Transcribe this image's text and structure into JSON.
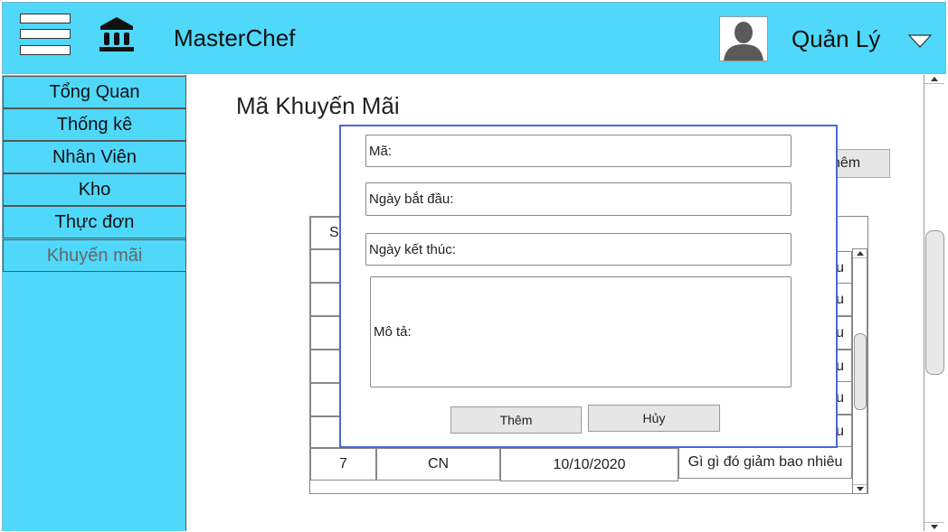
{
  "header": {
    "app_title": "MasterChef",
    "user_name": "Quản Lý",
    "icons": {
      "menu": "hamburger-menu-icon",
      "logo": "bank-icon",
      "avatar": "user-avatar",
      "dropdown": "chevron-down-icon"
    },
    "colors": {
      "header_bg": "#4fd8fa",
      "sidebar_bg": "#4fd8fa"
    }
  },
  "sidebar": {
    "items": [
      {
        "label": "Tổng Quan"
      },
      {
        "label": "Thống kê"
      },
      {
        "label": "Nhân Viên"
      },
      {
        "label": "Kho"
      },
      {
        "label": "Thực đơn"
      },
      {
        "label": "Khuyến mãi",
        "active": true
      }
    ]
  },
  "main": {
    "page_title": "Mã Khuyến Mãi",
    "add_button_label_partial": "hêm",
    "table": {
      "header_first_cell_partial": "S",
      "row_tail_partial": "u",
      "last_row": {
        "stt": "7",
        "ma": "CN",
        "ngay": "10/10/2020",
        "mo_ta": "Gì gì đó giảm bao nhiêu"
      }
    }
  },
  "dialog": {
    "fields": {
      "ma": "Mã:",
      "ngay_bat_dau": "Ngày bắt đầu:",
      "ngay_ket_thuc": "Ngày kết thúc:",
      "mo_ta": "Mô tả:"
    },
    "buttons": {
      "add": "Thêm",
      "cancel": "Hủy"
    },
    "colors": {
      "border": "#4a67d6"
    }
  }
}
